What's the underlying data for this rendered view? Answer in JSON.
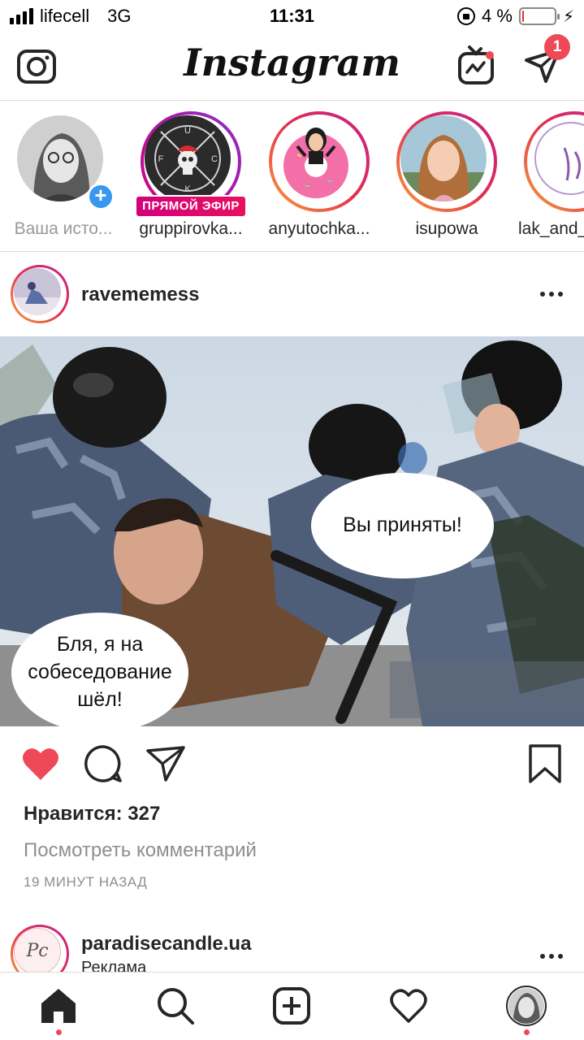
{
  "status_bar": {
    "carrier": "lifecell",
    "network": "3G",
    "time": "11:31",
    "battery_percent": "4 %",
    "battery_level": 0.04,
    "battery_color": "#e3302f"
  },
  "header": {
    "logo": "Instagram",
    "camera_icon": "camera-icon",
    "igtv_icon": "igtv-icon",
    "direct_icon": "paper-plane-icon",
    "direct_badge": "1"
  },
  "stories": [
    {
      "name": "Ваша исто...",
      "own": true
    },
    {
      "name": "gruppirovka...",
      "live_label": "ПРЯМОЙ ЭФИР"
    },
    {
      "name": "anyutochka..."
    },
    {
      "name": "isupowa"
    },
    {
      "name": "lak_and_"
    }
  ],
  "story_logo_letters": {
    "top": "U",
    "left": "F",
    "right": "C",
    "bottom": "K"
  },
  "post": {
    "username": "ravememess",
    "bubble_right": "Вы приняты!",
    "bubble_left": [
      "Бля, я на",
      "собеседование",
      "шёл!"
    ],
    "likes": "Нравится: 327",
    "view_comments": "Посмотреть комментарий",
    "time_ago": "19 МИНУТ НАЗАД",
    "like_color": "#ed4956"
  },
  "next_post": {
    "username": "paradisecandle.ua",
    "sponsored": "Реклама",
    "avatar_text": "Pc"
  },
  "tabbar": {
    "items": [
      "home-icon",
      "search-icon",
      "add-post-icon",
      "activity-heart-icon",
      "profile-avatar"
    ]
  }
}
